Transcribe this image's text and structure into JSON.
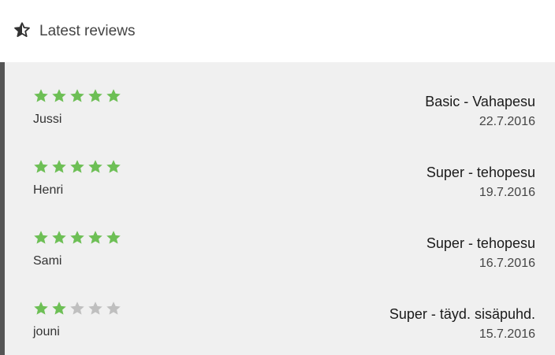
{
  "header": {
    "title": "Latest reviews",
    "icon": "star-half-icon"
  },
  "colors": {
    "star_filled": "#6dbf55",
    "star_empty": "#bfbfbf",
    "panel_bg": "#f0f0f0",
    "accent_bar": "#555555"
  },
  "reviews": [
    {
      "rating": 5,
      "max_rating": 5,
      "reviewer": "Jussi",
      "service": "Basic - Vahapesu",
      "date": "22.7.2016"
    },
    {
      "rating": 5,
      "max_rating": 5,
      "reviewer": "Henri",
      "service": "Super - tehopesu",
      "date": "19.7.2016"
    },
    {
      "rating": 5,
      "max_rating": 5,
      "reviewer": "Sami",
      "service": "Super - tehopesu",
      "date": "16.7.2016"
    },
    {
      "rating": 2,
      "max_rating": 5,
      "reviewer": "jouni",
      "service": "Super - täyd. sisäpuhd.",
      "date": "15.7.2016"
    }
  ]
}
